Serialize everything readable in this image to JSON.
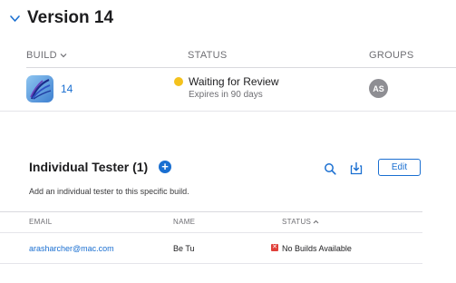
{
  "version": {
    "title": "Version 14"
  },
  "build_table": {
    "headers": {
      "build": "BUILD",
      "status": "STATUS",
      "groups": "GROUPS"
    },
    "row": {
      "build_number": "14",
      "status": "Waiting for Review",
      "status_color": "#f4c21d",
      "expires": "Expires in 90 days",
      "group_initials": "AS"
    }
  },
  "testers": {
    "title": "Individual Tester (1)",
    "description": "Add an individual tester to this specific build.",
    "edit_label": "Edit",
    "icons": {
      "add": "plus-circle-icon",
      "search": "search-icon",
      "download": "download-icon"
    },
    "headers": {
      "email": "EMAIL",
      "name": "NAME",
      "status": "STATUS"
    },
    "rows": [
      {
        "email": "arasharcher@mac.com",
        "name": "Be Tu",
        "status": "No Builds Available",
        "status_color": "#e0403a"
      }
    ]
  },
  "colors": {
    "accent": "#1a6fd1"
  }
}
